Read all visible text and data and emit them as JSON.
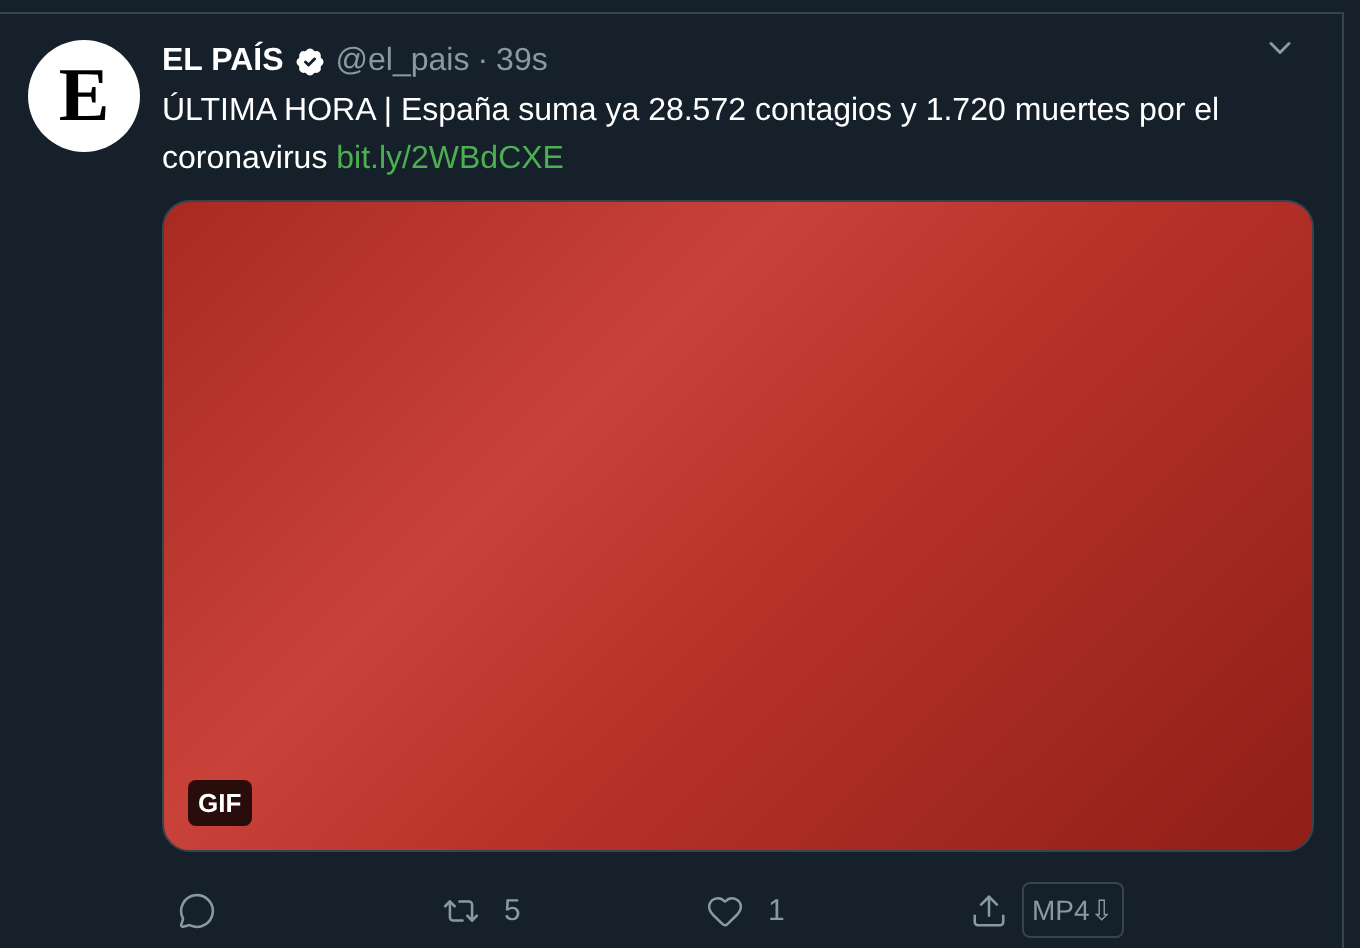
{
  "tweet": {
    "avatar_letter": "E",
    "author": "EL PAÍS",
    "verified": true,
    "handle": "@el_pais",
    "separator": "·",
    "time": "39s",
    "text": "ÚLTIMA HORA | España suma ya 28.572 contagios y 1.720 muertes por el coronavirus",
    "link": "bit.ly/2WBdCXE",
    "media": {
      "badge": "GIF"
    },
    "actions": [
      {
        "kind": "reply"
      },
      {
        "kind": "retweet",
        "count": "5"
      },
      {
        "kind": "like",
        "count": "1"
      },
      {
        "kind": "share"
      }
    ],
    "download": "MP4⇩"
  }
}
